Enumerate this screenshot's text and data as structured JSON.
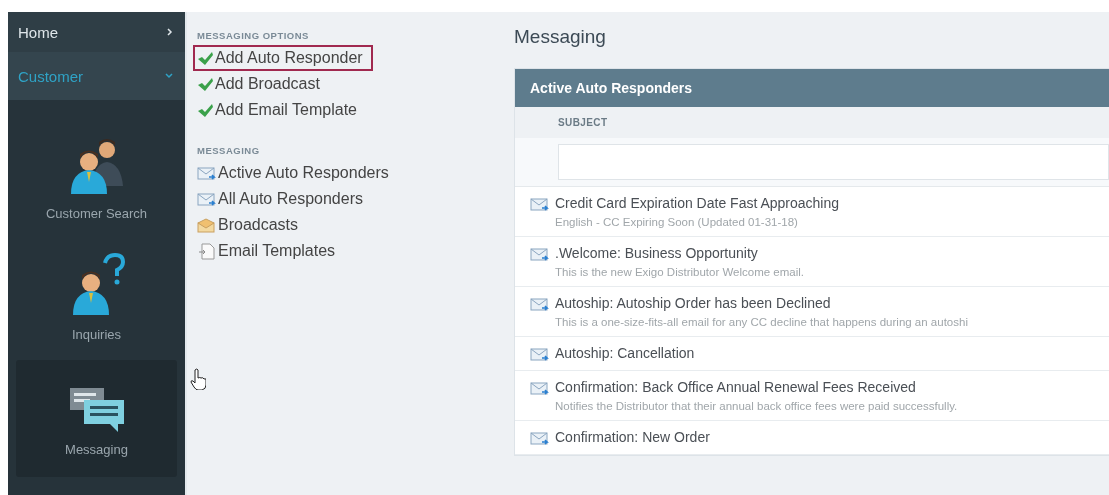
{
  "sidebar": {
    "nav": [
      {
        "label": "Home",
        "expanded": false,
        "selected": false
      },
      {
        "label": "Customer",
        "expanded": true,
        "selected": true
      }
    ],
    "tiles": [
      {
        "label": "Customer Search",
        "kind": "people",
        "selected": false
      },
      {
        "label": "Inquiries",
        "kind": "question",
        "selected": false
      },
      {
        "label": "Messaging",
        "kind": "chat",
        "selected": true
      }
    ]
  },
  "menu": {
    "sections": [
      {
        "heading": "MESSAGING OPTIONS",
        "items": [
          {
            "label": "Add Auto Responder",
            "kind": "check",
            "selected": true
          },
          {
            "label": "Add Broadcast",
            "kind": "check",
            "selected": false
          },
          {
            "label": "Add Email Template",
            "kind": "check",
            "selected": false
          }
        ]
      },
      {
        "heading": "MESSAGING",
        "items": [
          {
            "label": "Active Auto Responders",
            "kind": "mail",
            "selected": false
          },
          {
            "label": "All Auto Responders",
            "kind": "mail",
            "selected": false
          },
          {
            "label": "Broadcasts",
            "kind": "envelope",
            "selected": false
          },
          {
            "label": "Email Templates",
            "kind": "document",
            "selected": false
          }
        ]
      }
    ]
  },
  "page": {
    "title": "Messaging",
    "panel": {
      "title": "Active Auto Responders",
      "column": "SUBJECT",
      "rows": [
        {
          "subject": "Credit Card Expiration Date Fast Approaching",
          "description": "English - CC Expiring Soon (Updated 01-31-18)"
        },
        {
          "subject": ".Welcome: Business Opportunity",
          "description": "This is the new Exigo Distributor Welcome email."
        },
        {
          "subject": "Autoship: Autoship Order has been Declined",
          "description": "This is a one-size-fits-all email for any CC decline that happens during an autoshi"
        },
        {
          "subject": "Autoship: Cancellation"
        },
        {
          "subject": "Confirmation: Back Office Annual Renewal Fees Received",
          "description": "Notifies the Distributor that their annual back office fees were paid successfully."
        },
        {
          "subject": "Confirmation: New Order"
        }
      ]
    }
  }
}
